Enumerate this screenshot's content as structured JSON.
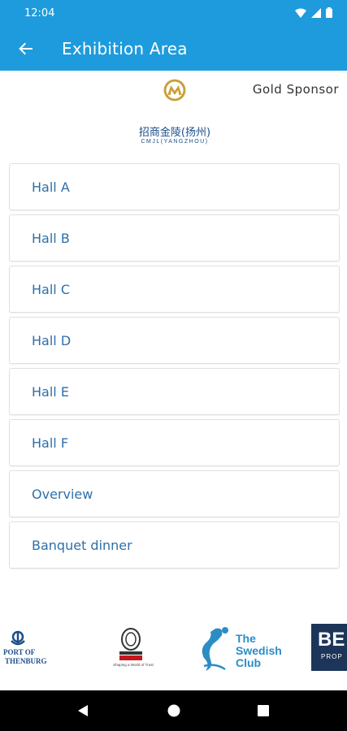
{
  "status_bar": {
    "time": "12:04"
  },
  "app_bar": {
    "title": "Exhibition Area"
  },
  "sponsor": {
    "label": "Gold Sponsor",
    "name_cn": "招商金陵(扬州)",
    "name_en": "CMJL(YANGZHOU)"
  },
  "halls": [
    {
      "label": "Hall A"
    },
    {
      "label": "Hall B"
    },
    {
      "label": "Hall C"
    },
    {
      "label": "Hall D"
    },
    {
      "label": "Hall E"
    },
    {
      "label": "Hall F"
    },
    {
      "label": "Overview"
    },
    {
      "label": "Banquet dinner"
    }
  ],
  "partners": {
    "port_line1": "PORT OF",
    "port_line2": "THENBURG",
    "bv_tagline": "Shaping a World of Trust",
    "swedish_line1": "The",
    "swedish_line2": "Swedish",
    "swedish_line3": "Club",
    "be_text": "BE",
    "be_sub": "PROP"
  },
  "colors": {
    "primary": "#1e9bdc",
    "hall_text": "#2f6fa8",
    "sponsor_gold": "#c8a03a",
    "sponsor_blue": "#1b4f8a"
  },
  "icons": {
    "back": "arrow-left-icon",
    "wifi": "wifi-icon",
    "signal": "signal-icon",
    "battery": "battery-icon"
  }
}
